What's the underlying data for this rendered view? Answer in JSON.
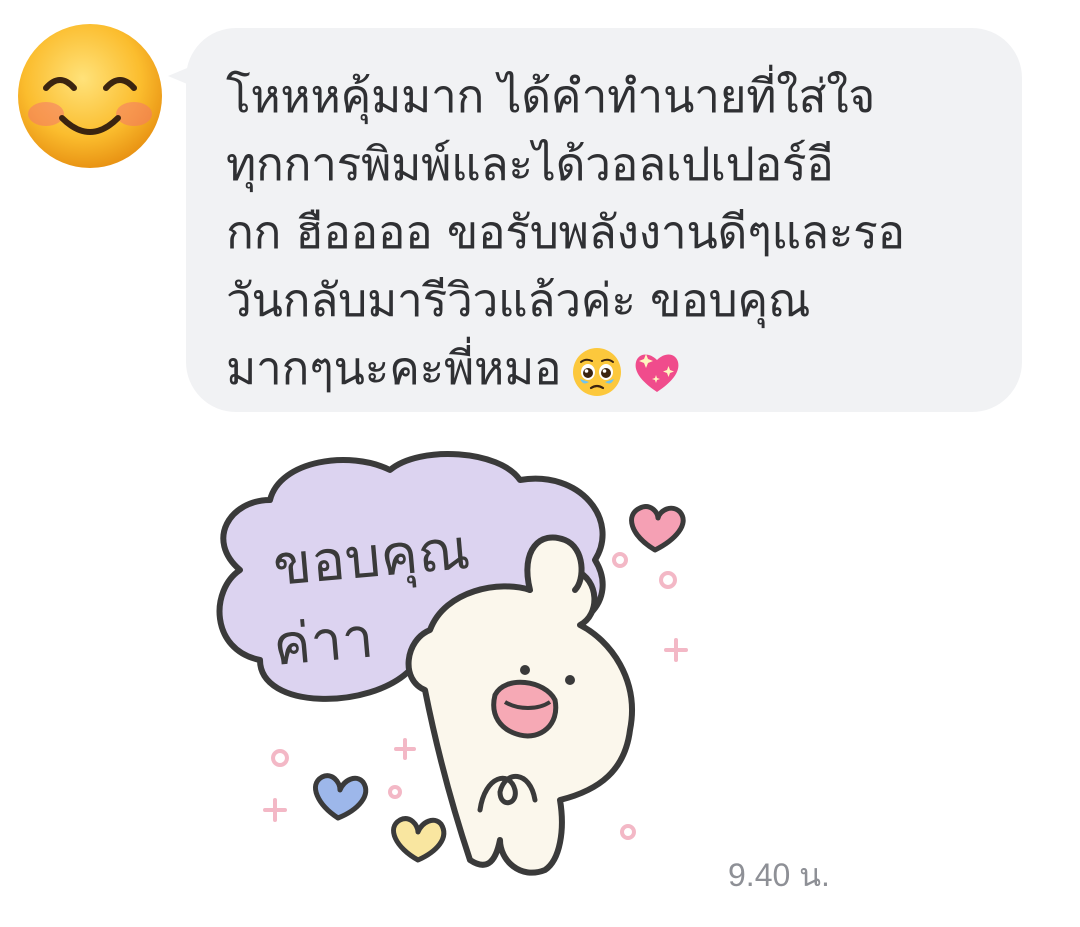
{
  "message": {
    "lines": [
      "โหหหคุ้มมาก ได้คำทำนายที่ใส่ใจ",
      "ทุกการพิมพ์และได้วอลเปเปอร์อี",
      "กก ฮืออออ ขอรับพลังงานดีๆและรอ",
      "วันกลับมารีวิวแล้วค่ะ ขอบคุณ",
      "มากๆนะคะพี่หมอ"
    ],
    "trailing_emojis": [
      "pleading-face-icon",
      "sparkling-heart-icon"
    ],
    "bubble_color": "#f1f2f4",
    "text_color": "#2f3033"
  },
  "sender": {
    "avatar_icon": "smiling-face-icon"
  },
  "sticker": {
    "text_line1": "ขอบคุณ",
    "text_line2": "ค่าา",
    "cloud_color": "#dcd3f0"
  },
  "timestamp": "9.40 น."
}
